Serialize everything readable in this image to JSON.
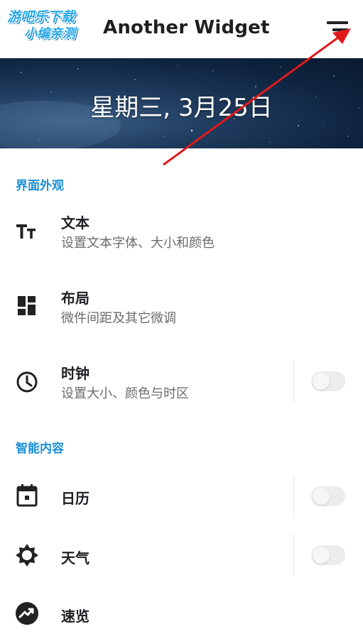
{
  "watermark": {
    "line1": "游吧乐下载",
    "line2": "小编亲测"
  },
  "app": {
    "title": "Another Widget"
  },
  "banner": {
    "date": "星期三, 3月25日"
  },
  "sections": [
    {
      "header": "界面外观"
    },
    {
      "header": "智能内容"
    }
  ],
  "rows": {
    "text": {
      "title": "文本",
      "subtitle": "设置文本字体、大小和颜色",
      "icon": "text-size-icon"
    },
    "layout": {
      "title": "布局",
      "subtitle": "微件间距及其它微调",
      "icon": "dashboard-icon"
    },
    "clock": {
      "title": "时钟",
      "subtitle": "设置大小、颜色与时区",
      "icon": "clock-icon",
      "toggle": "off"
    },
    "calendar": {
      "title": "日历",
      "icon": "calendar-icon",
      "toggle": "off"
    },
    "weather": {
      "title": "天气",
      "icon": "weather-sun-icon",
      "toggle": "off"
    },
    "glance": {
      "title": "速览",
      "icon": "trending-icon"
    }
  },
  "colors": {
    "accent": "#1a8fd4",
    "annotation_arrow": "#e0191b",
    "toggle_off": "#ececec"
  }
}
